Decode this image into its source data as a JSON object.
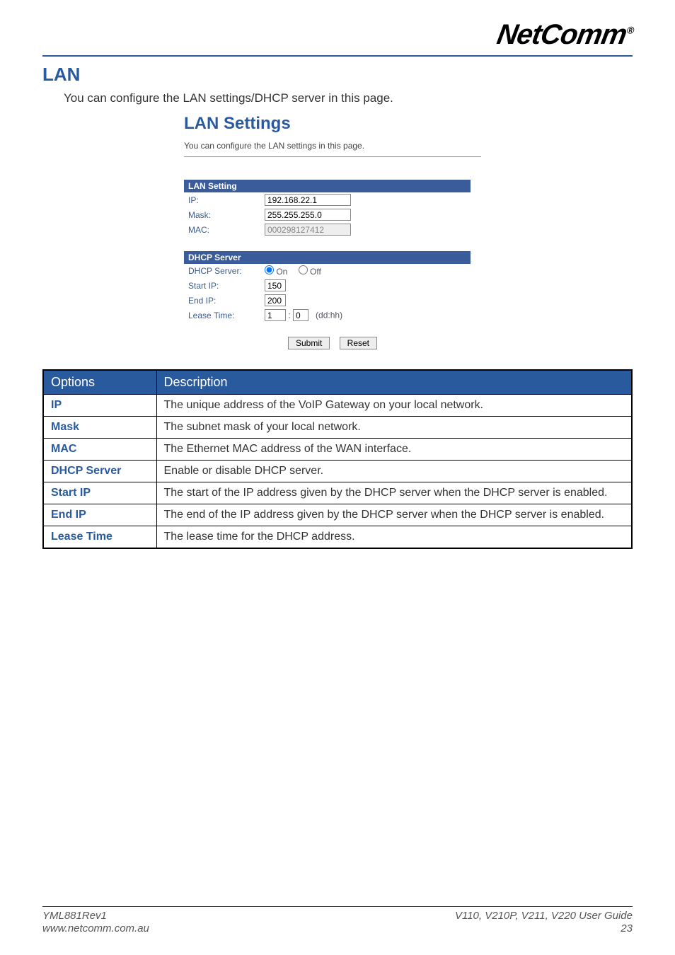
{
  "brand": "NetComm",
  "brand_reg": "®",
  "section": {
    "title": "LAN",
    "intro": "You can configure the LAN settings/DHCP server in this page."
  },
  "embedded": {
    "title": "LAN Settings",
    "subtitle": "You can configure the LAN settings in this page.",
    "lan_section_header": "LAN Setting",
    "lan": {
      "ip_label": "IP:",
      "ip_value": "192.168.22.1",
      "mask_label": "Mask:",
      "mask_value": "255.255.255.0",
      "mac_label": "MAC:",
      "mac_value": "000298127412"
    },
    "dhcp_section_header": "DHCP Server",
    "dhcp": {
      "server_label": "DHCP Server:",
      "on_label": "On",
      "off_label": "Off",
      "start_ip_label": "Start IP:",
      "start_ip_value": "150",
      "end_ip_label": "End IP:",
      "end_ip_value": "200",
      "lease_time_label": "Lease Time:",
      "lease_dd_value": "1",
      "lease_sep": ":",
      "lease_hh_value": "0",
      "lease_hint": "(dd:hh)"
    },
    "submit_label": "Submit",
    "reset_label": "Reset"
  },
  "desc_table": {
    "header_option": "Options",
    "header_desc": "Description",
    "rows": [
      {
        "opt": "IP",
        "desc": "The unique address of the VoIP Gateway on your local network."
      },
      {
        "opt": "Mask",
        "desc": "The subnet mask of your local network."
      },
      {
        "opt": "MAC",
        "desc": "The Ethernet MAC address of the WAN interface."
      },
      {
        "opt": "DHCP Server",
        "desc": "Enable or disable DHCP server."
      },
      {
        "opt": "Start IP",
        "desc": "The start of the IP address given by the DHCP server when the DHCP server is enabled."
      },
      {
        "opt": "End IP",
        "desc": "The end of the IP address given by the DHCP server when the DHCP server is enabled."
      },
      {
        "opt": "Lease Time",
        "desc": "The lease time for the DHCP address."
      }
    ]
  },
  "footer": {
    "rev": "YML881Rev1",
    "url": "www.netcomm.com.au",
    "models": "V110, V210P, V211, V220",
    "guide": " User Guide",
    "page": "23"
  }
}
